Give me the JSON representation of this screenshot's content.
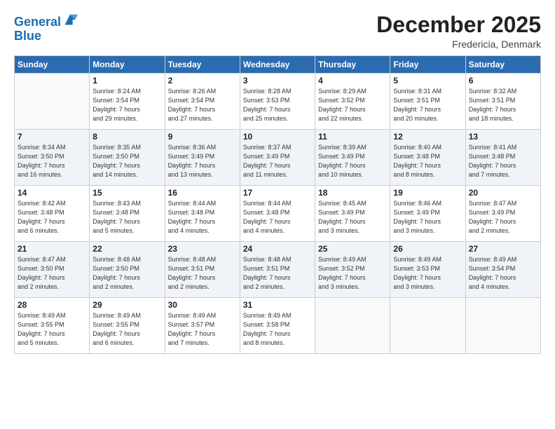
{
  "logo": {
    "line1": "General",
    "line2": "Blue"
  },
  "title": "December 2025",
  "location": "Fredericia, Denmark",
  "weekdays": [
    "Sunday",
    "Monday",
    "Tuesday",
    "Wednesday",
    "Thursday",
    "Friday",
    "Saturday"
  ],
  "weeks": [
    [
      {
        "day": "",
        "info": ""
      },
      {
        "day": "1",
        "info": "Sunrise: 8:24 AM\nSunset: 3:54 PM\nDaylight: 7 hours\nand 29 minutes."
      },
      {
        "day": "2",
        "info": "Sunrise: 8:26 AM\nSunset: 3:54 PM\nDaylight: 7 hours\nand 27 minutes."
      },
      {
        "day": "3",
        "info": "Sunrise: 8:28 AM\nSunset: 3:53 PM\nDaylight: 7 hours\nand 25 minutes."
      },
      {
        "day": "4",
        "info": "Sunrise: 8:29 AM\nSunset: 3:52 PM\nDaylight: 7 hours\nand 22 minutes."
      },
      {
        "day": "5",
        "info": "Sunrise: 8:31 AM\nSunset: 3:51 PM\nDaylight: 7 hours\nand 20 minutes."
      },
      {
        "day": "6",
        "info": "Sunrise: 8:32 AM\nSunset: 3:51 PM\nDaylight: 7 hours\nand 18 minutes."
      }
    ],
    [
      {
        "day": "7",
        "info": "Sunrise: 8:34 AM\nSunset: 3:50 PM\nDaylight: 7 hours\nand 16 minutes."
      },
      {
        "day": "8",
        "info": "Sunrise: 8:35 AM\nSunset: 3:50 PM\nDaylight: 7 hours\nand 14 minutes."
      },
      {
        "day": "9",
        "info": "Sunrise: 8:36 AM\nSunset: 3:49 PM\nDaylight: 7 hours\nand 13 minutes."
      },
      {
        "day": "10",
        "info": "Sunrise: 8:37 AM\nSunset: 3:49 PM\nDaylight: 7 hours\nand 11 minutes."
      },
      {
        "day": "11",
        "info": "Sunrise: 8:39 AM\nSunset: 3:49 PM\nDaylight: 7 hours\nand 10 minutes."
      },
      {
        "day": "12",
        "info": "Sunrise: 8:40 AM\nSunset: 3:48 PM\nDaylight: 7 hours\nand 8 minutes."
      },
      {
        "day": "13",
        "info": "Sunrise: 8:41 AM\nSunset: 3:48 PM\nDaylight: 7 hours\nand 7 minutes."
      }
    ],
    [
      {
        "day": "14",
        "info": "Sunrise: 8:42 AM\nSunset: 3:48 PM\nDaylight: 7 hours\nand 6 minutes."
      },
      {
        "day": "15",
        "info": "Sunrise: 8:43 AM\nSunset: 3:48 PM\nDaylight: 7 hours\nand 5 minutes."
      },
      {
        "day": "16",
        "info": "Sunrise: 8:44 AM\nSunset: 3:48 PM\nDaylight: 7 hours\nand 4 minutes."
      },
      {
        "day": "17",
        "info": "Sunrise: 8:44 AM\nSunset: 3:48 PM\nDaylight: 7 hours\nand 4 minutes."
      },
      {
        "day": "18",
        "info": "Sunrise: 8:45 AM\nSunset: 3:49 PM\nDaylight: 7 hours\nand 3 minutes."
      },
      {
        "day": "19",
        "info": "Sunrise: 8:46 AM\nSunset: 3:49 PM\nDaylight: 7 hours\nand 3 minutes."
      },
      {
        "day": "20",
        "info": "Sunrise: 8:47 AM\nSunset: 3:49 PM\nDaylight: 7 hours\nand 2 minutes."
      }
    ],
    [
      {
        "day": "21",
        "info": "Sunrise: 8:47 AM\nSunset: 3:50 PM\nDaylight: 7 hours\nand 2 minutes."
      },
      {
        "day": "22",
        "info": "Sunrise: 8:48 AM\nSunset: 3:50 PM\nDaylight: 7 hours\nand 2 minutes."
      },
      {
        "day": "23",
        "info": "Sunrise: 8:48 AM\nSunset: 3:51 PM\nDaylight: 7 hours\nand 2 minutes."
      },
      {
        "day": "24",
        "info": "Sunrise: 8:48 AM\nSunset: 3:51 PM\nDaylight: 7 hours\nand 2 minutes."
      },
      {
        "day": "25",
        "info": "Sunrise: 8:49 AM\nSunset: 3:52 PM\nDaylight: 7 hours\nand 3 minutes."
      },
      {
        "day": "26",
        "info": "Sunrise: 8:49 AM\nSunset: 3:53 PM\nDaylight: 7 hours\nand 3 minutes."
      },
      {
        "day": "27",
        "info": "Sunrise: 8:49 AM\nSunset: 3:54 PM\nDaylight: 7 hours\nand 4 minutes."
      }
    ],
    [
      {
        "day": "28",
        "info": "Sunrise: 8:49 AM\nSunset: 3:55 PM\nDaylight: 7 hours\nand 5 minutes."
      },
      {
        "day": "29",
        "info": "Sunrise: 8:49 AM\nSunset: 3:55 PM\nDaylight: 7 hours\nand 6 minutes."
      },
      {
        "day": "30",
        "info": "Sunrise: 8:49 AM\nSunset: 3:57 PM\nDaylight: 7 hours\nand 7 minutes."
      },
      {
        "day": "31",
        "info": "Sunrise: 8:49 AM\nSunset: 3:58 PM\nDaylight: 7 hours\nand 8 minutes."
      },
      {
        "day": "",
        "info": ""
      },
      {
        "day": "",
        "info": ""
      },
      {
        "day": "",
        "info": ""
      }
    ]
  ]
}
